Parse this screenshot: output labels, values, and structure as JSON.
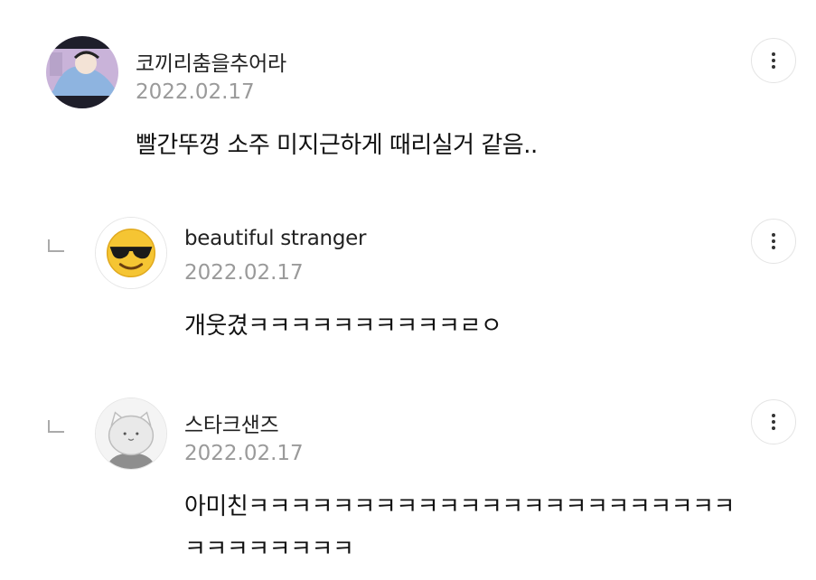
{
  "comments": [
    {
      "author": "코끼리춤을추어라",
      "date": "2022.02.17",
      "text": "빨간뚜껑 소주 미지근하게 때리실거 같음..",
      "avatar_icon": "avatar-illustration-icon",
      "more_icon": "more-vertical-icon"
    },
    {
      "author": "beautiful stranger",
      "date": "2022.02.17",
      "text": "개웃겼ㅋㅋㅋㅋㅋㅋㅋㅋㅋㅋㄹㅇ",
      "avatar_icon": "sunglasses-emoji-icon",
      "more_icon": "more-vertical-icon",
      "is_reply": true
    },
    {
      "author": "스타크샌즈",
      "date": "2022.02.17",
      "text": "아미친ㅋㅋㅋㅋㅋㅋㅋㅋㅋㅋㅋㅋㅋㅋㅋㅋㅋㅋㅋㅋㅋㅋㅋㅋㅋㅋㅋㅋㅋㅋㅋ",
      "avatar_icon": "default-cat-avatar-icon",
      "more_icon": "more-vertical-icon",
      "is_reply": true
    }
  ]
}
